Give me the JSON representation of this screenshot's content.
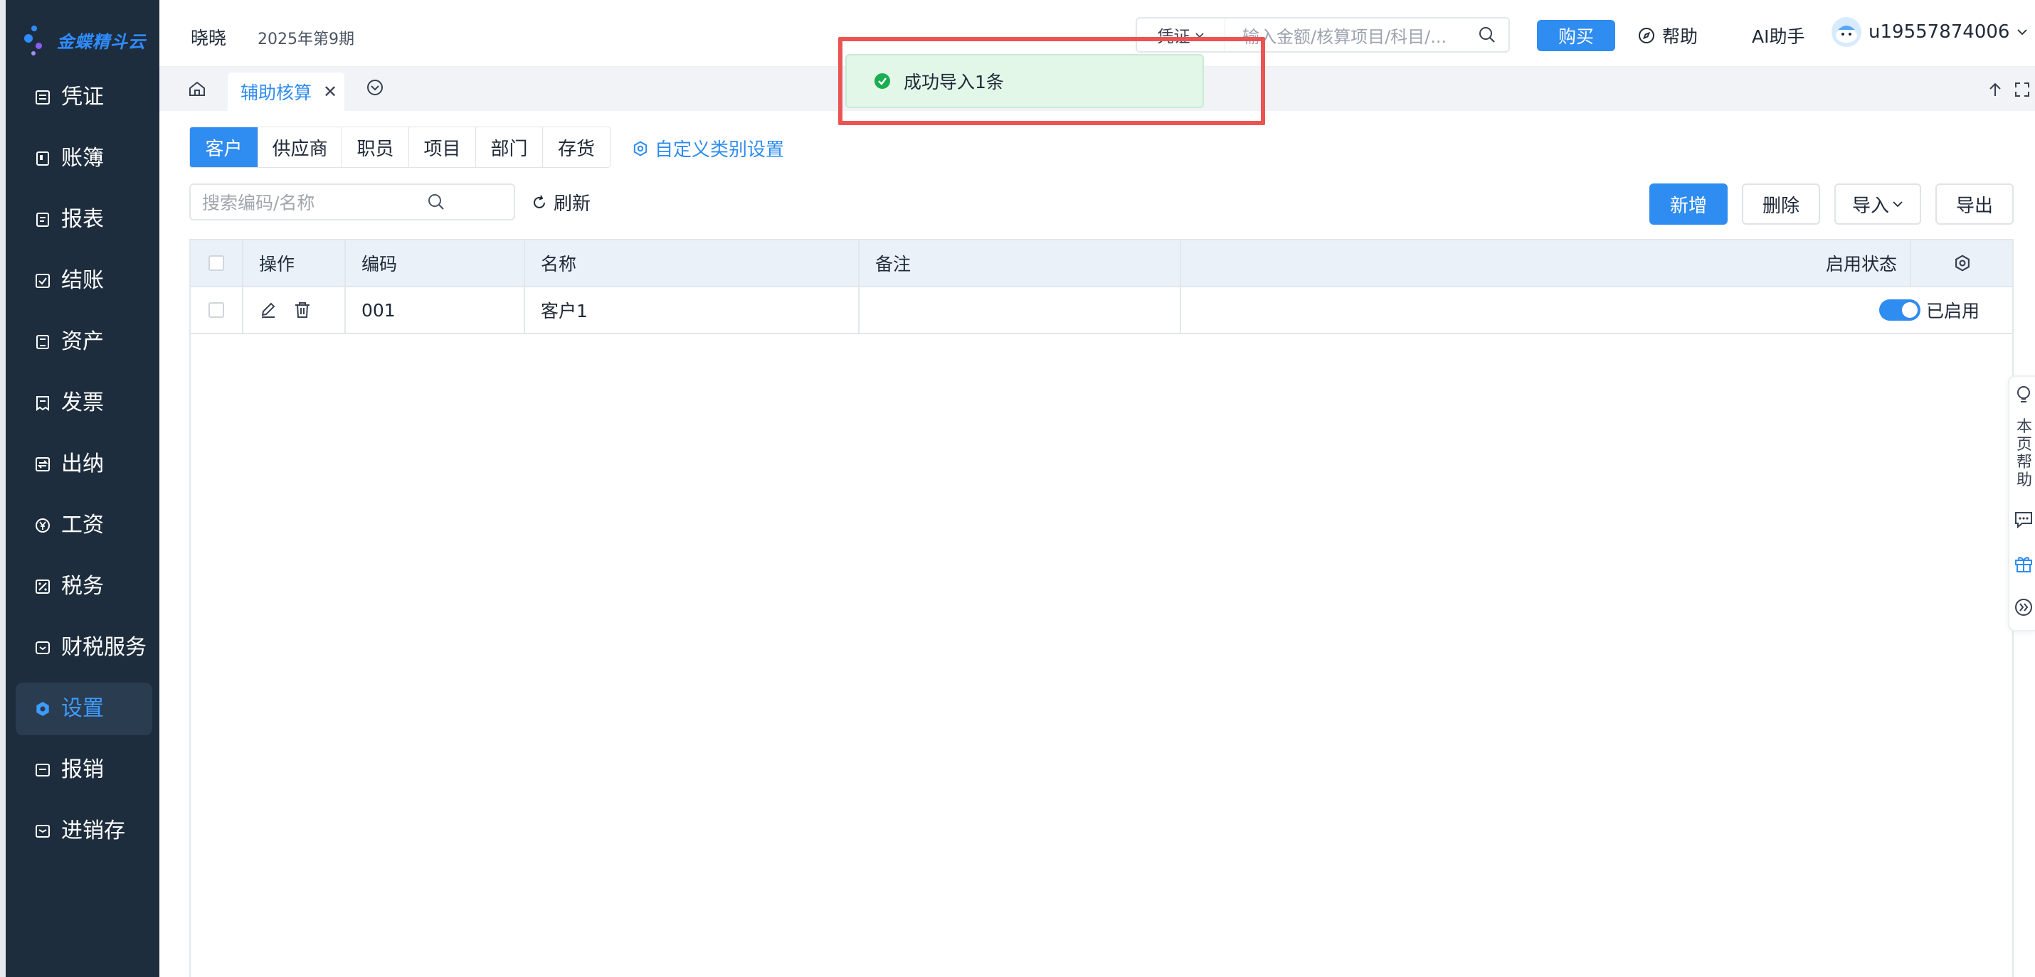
{
  "app": {
    "logo_text": "金蝶精斗云"
  },
  "header": {
    "company": "晓晓",
    "period": "2025年第9期",
    "search_type": "凭证",
    "search_placeholder": "输入金额/核算项目/科目/...",
    "buy_label": "购买",
    "help_label": "帮助",
    "ai_label": "AI助手",
    "username": "u19557874006"
  },
  "sidebar": {
    "items": [
      {
        "label": "凭证",
        "icon": "voucher-icon"
      },
      {
        "label": "账簿",
        "icon": "ledger-icon"
      },
      {
        "label": "报表",
        "icon": "report-icon"
      },
      {
        "label": "结账",
        "icon": "closing-icon"
      },
      {
        "label": "资产",
        "icon": "asset-icon"
      },
      {
        "label": "发票",
        "icon": "invoice-icon"
      },
      {
        "label": "出纳",
        "icon": "cashier-icon"
      },
      {
        "label": "工资",
        "icon": "salary-icon"
      },
      {
        "label": "税务",
        "icon": "tax-icon"
      },
      {
        "label": "财税服务",
        "icon": "finance-service-icon"
      },
      {
        "label": "设置",
        "icon": "settings-icon"
      },
      {
        "label": "报销",
        "icon": "reimburse-icon"
      },
      {
        "label": "进销存",
        "icon": "inventory-icon"
      }
    ],
    "active_index": 10
  },
  "tabs": {
    "active_tab": "辅助核算"
  },
  "categories": {
    "items": [
      "客户",
      "供应商",
      "职员",
      "项目",
      "部门",
      "存货"
    ],
    "active": "客户",
    "custom_label": "自定义类别设置"
  },
  "toolbar": {
    "search_placeholder": "搜索编码/名称",
    "refresh_label": "刷新",
    "add_label": "新增",
    "delete_label": "删除",
    "import_label": "导入",
    "export_label": "导出"
  },
  "table": {
    "headers": {
      "action": "操作",
      "code": "编码",
      "name": "名称",
      "remark": "备注",
      "status": "启用状态"
    },
    "rows": [
      {
        "code": "001",
        "name": "客户1",
        "remark": "",
        "status": "已启用"
      }
    ]
  },
  "right_rail": {
    "help_text": "本页帮助"
  },
  "toast": {
    "message": "成功导入1条",
    "type": "success"
  },
  "colors": {
    "accent": "#2f8cf0",
    "sidebar_bg": "#1e2d3d",
    "success": "#1aad52",
    "highlight": "#ec5454"
  }
}
